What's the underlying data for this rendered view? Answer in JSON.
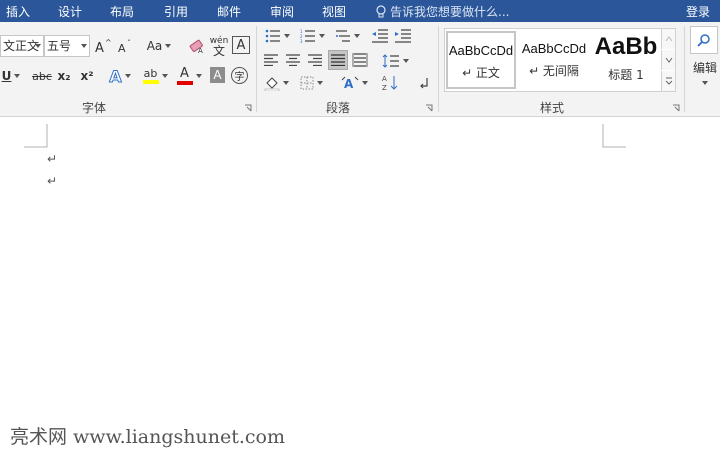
{
  "tabs": [
    "插入",
    "设计",
    "布局",
    "引用",
    "邮件",
    "审阅",
    "视图"
  ],
  "tell_me": "告诉我您想要做什么...",
  "login": "登录",
  "font": {
    "name": "文正文",
    "size": "五号",
    "label": "字体",
    "change_case_label": "Aa",
    "phonetic_top": "wén",
    "phonetic_bottom": "文",
    "char_border": "A",
    "underline": "U",
    "strike": "abc",
    "subscript": "x₂",
    "superscript": "x²",
    "text_effects": "A",
    "highlight": "ab",
    "font_color": "A",
    "char_shading": "A",
    "enclose": "字",
    "highlight_color": "#ffff00",
    "font_color_value": "#e00000"
  },
  "paragraph": {
    "label": "段落"
  },
  "styles": {
    "label": "样式",
    "items": [
      {
        "sample": "AaBbCcDd",
        "name": "↵ 正文"
      },
      {
        "sample": "AaBbCcDd",
        "name": "↵ 无间隔"
      },
      {
        "sample": "AaBb",
        "name": "标题 1"
      }
    ]
  },
  "editing": {
    "label": "编辑"
  },
  "document": {
    "marks": [
      "↵",
      "↵"
    ]
  },
  "watermark": "亮术网 www.liangshunet.com"
}
